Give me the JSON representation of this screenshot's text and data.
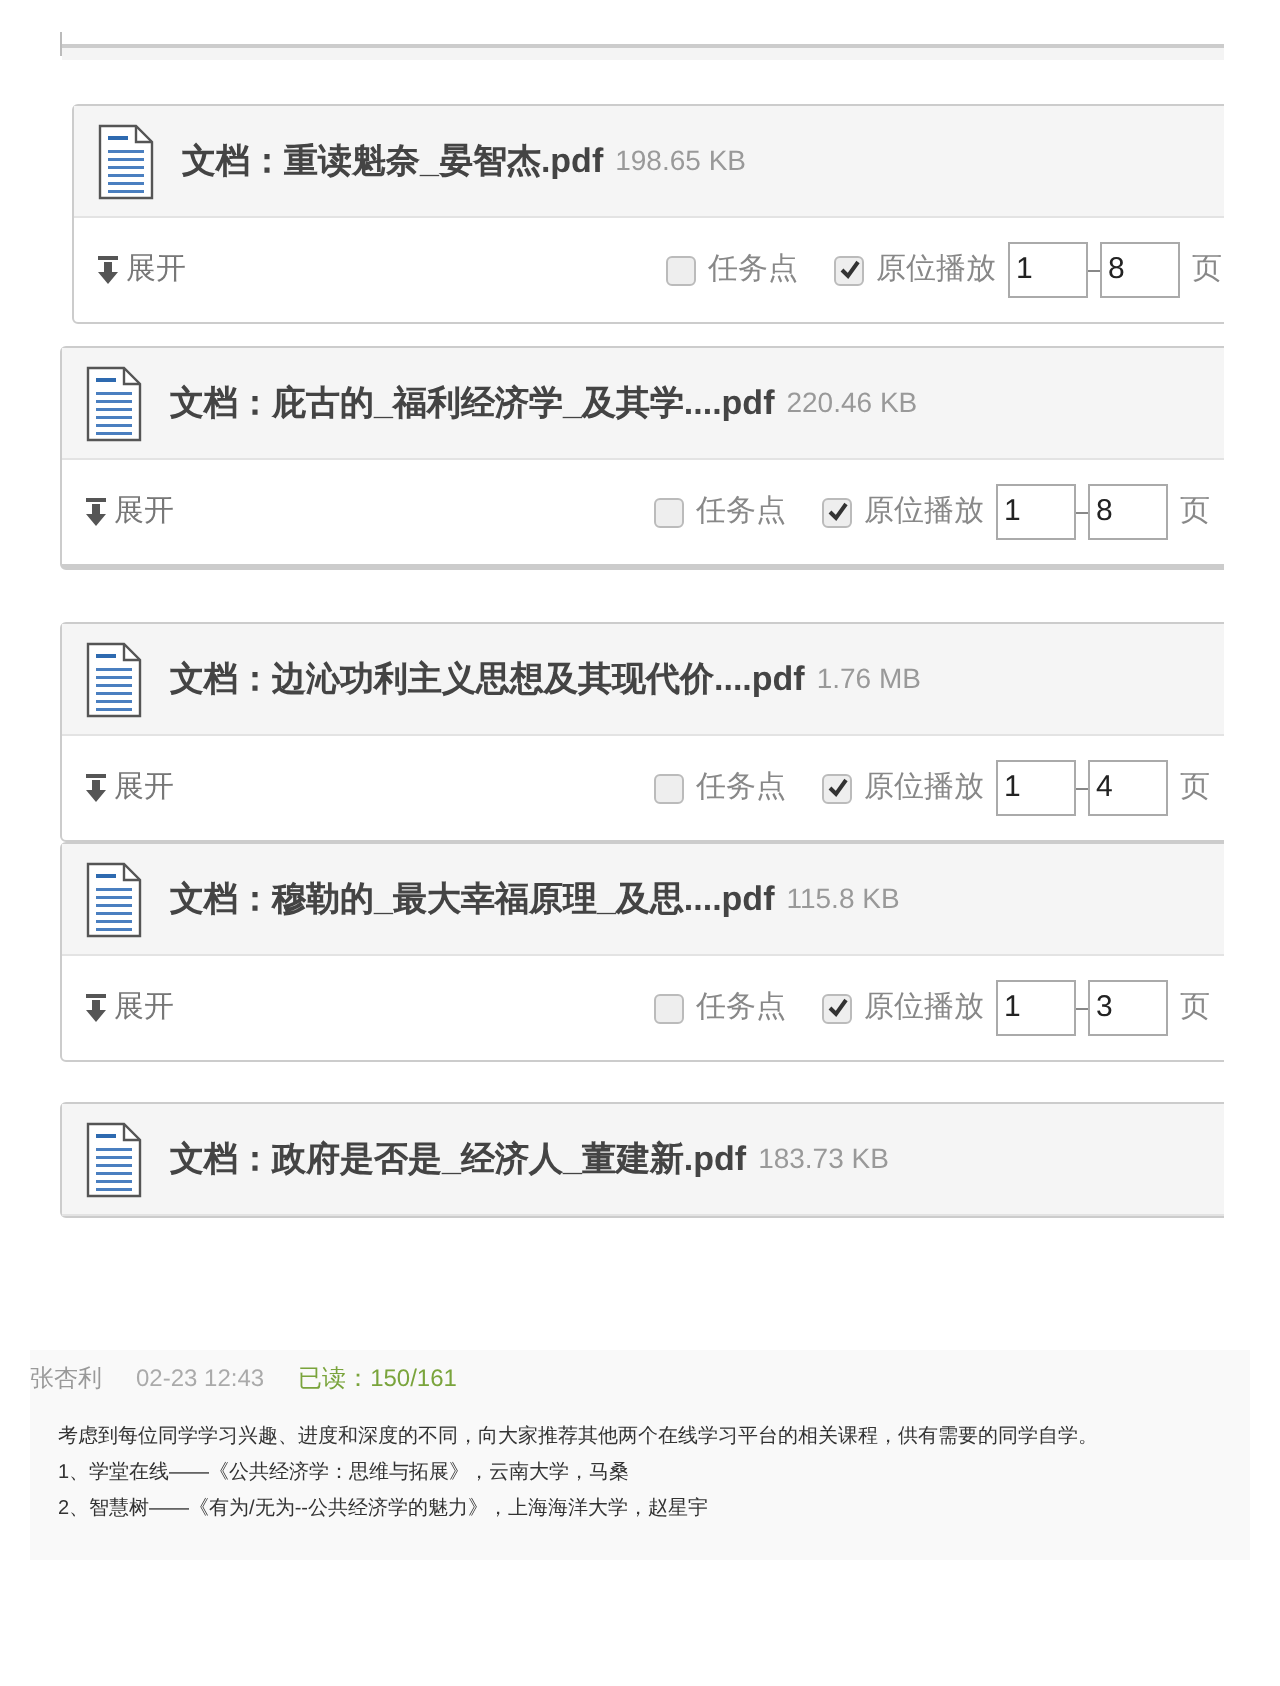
{
  "documents": [
    {
      "title": "文档：重读魁奈_晏智杰.pdf",
      "size": "198.65 KB",
      "toolbar": {
        "expand": "展开",
        "task_point": {
          "label": "任务点",
          "checked": false
        },
        "in_place": {
          "label": "原位播放",
          "checked": true
        },
        "page_from": "1",
        "page_to": "8",
        "page_unit": "页"
      }
    },
    {
      "title": "文档：庇古的_福利经济学_及其学....pdf",
      "size": "220.46 KB",
      "toolbar": {
        "expand": "展开",
        "task_point": {
          "label": "任务点",
          "checked": false
        },
        "in_place": {
          "label": "原位播放",
          "checked": true
        },
        "page_from": "1",
        "page_to": "8",
        "page_unit": "页"
      }
    },
    {
      "title": "文档：边沁功利主义思想及其现代价....pdf",
      "size": "1.76 MB",
      "toolbar": {
        "expand": "展开",
        "task_point": {
          "label": "任务点",
          "checked": false
        },
        "in_place": {
          "label": "原位播放",
          "checked": true
        },
        "page_from": "1",
        "page_to": "4",
        "page_unit": "页"
      }
    },
    {
      "title": "文档：穆勒的_最大幸福原理_及思....pdf",
      "size": "115.8 KB",
      "toolbar": {
        "expand": "展开",
        "task_point": {
          "label": "任务点",
          "checked": false
        },
        "in_place": {
          "label": "原位播放",
          "checked": true
        },
        "page_from": "1",
        "page_to": "3",
        "page_unit": "页"
      }
    },
    {
      "title": "文档：政府是否是_经济人_董建新.pdf",
      "size": "183.73 KB"
    }
  ],
  "post": {
    "author": "张杏利",
    "time": "02-23 12:43",
    "read": "已读：150/161",
    "lines": [
      "考虑到每位同学学习兴趣、进度和深度的不同，向大家推荐其他两个在线学习平台的相关课程，供有需要的同学自学。",
      "1、学堂在线——《公共经济学：思维与拓展》，云南大学，马桑",
      "2、智慧树——《有为/无为--公共经济学的魅力》，上海海洋大学，赵星宇"
    ]
  }
}
